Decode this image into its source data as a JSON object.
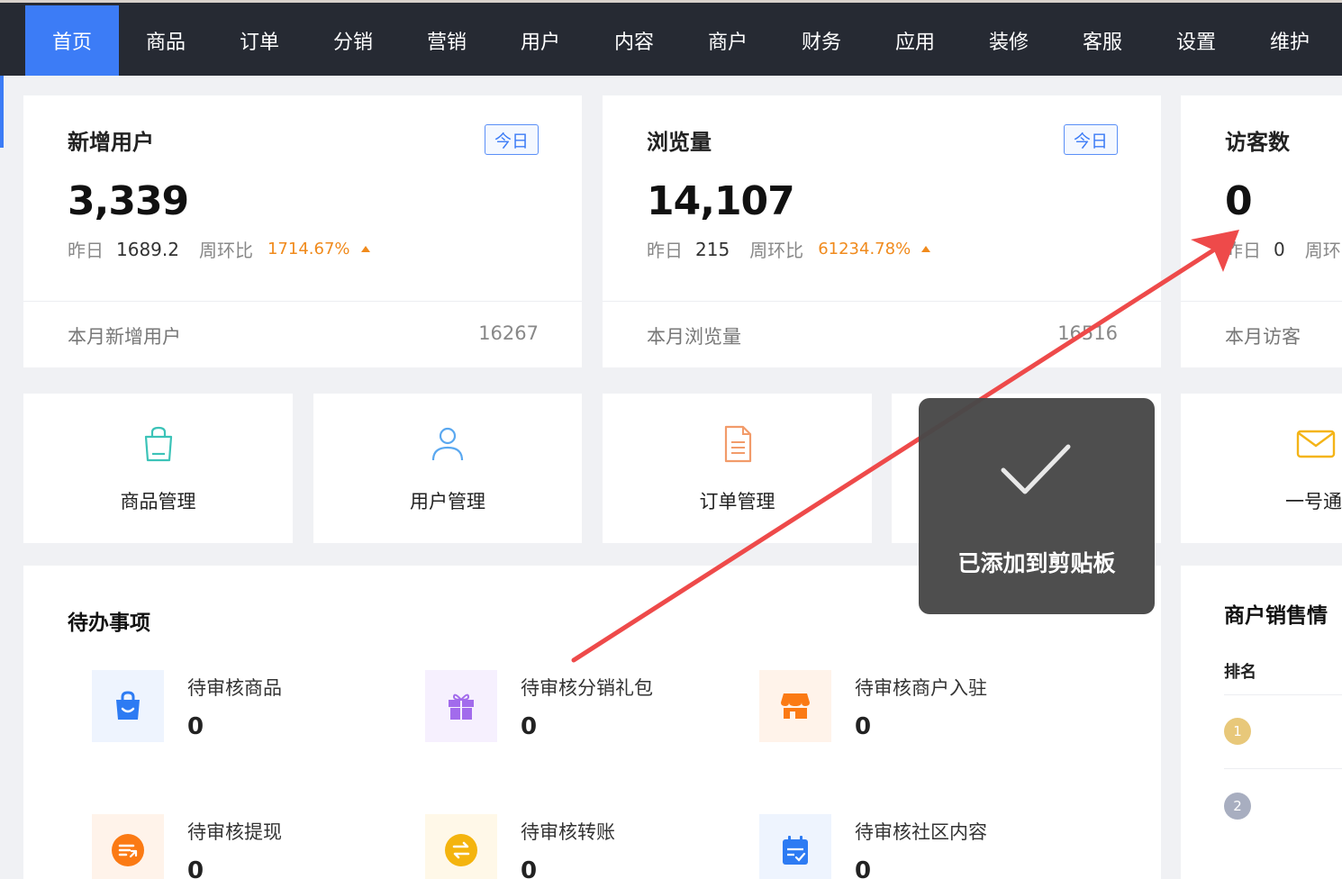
{
  "nav": {
    "items": [
      "首页",
      "商品",
      "订单",
      "分销",
      "营销",
      "用户",
      "内容",
      "商户",
      "财务",
      "应用",
      "装修",
      "客服",
      "设置",
      "维护"
    ],
    "active_index": 0,
    "accent_color": "#3c7cf6"
  },
  "stats": [
    {
      "title": "新增用户",
      "badge": "今日",
      "value": "3,339",
      "yesterday_label": "昨日",
      "yesterday_value": "1689.2",
      "wow_label": "周环比",
      "wow_value": "1714.67%",
      "footer_label": "本月新增用户",
      "footer_value": "16267"
    },
    {
      "title": "浏览量",
      "badge": "今日",
      "value": "14,107",
      "yesterday_label": "昨日",
      "yesterday_value": "215",
      "wow_label": "周环比",
      "wow_value": "61234.78%",
      "footer_label": "本月浏览量",
      "footer_value": "16516"
    },
    {
      "title": "访客数",
      "value": "0",
      "yesterday_label": "昨日",
      "yesterday_value": "0",
      "wow_label": "周环",
      "footer_label": "本月访客"
    }
  ],
  "quick_links": [
    {
      "label": "商品管理",
      "icon": "shopping-bag-icon"
    },
    {
      "label": "用户管理",
      "icon": "user-icon"
    },
    {
      "label": "订单管理",
      "icon": "document-icon"
    },
    {
      "label": "",
      "icon": ""
    },
    {
      "label": "一号通",
      "icon": "mail-icon"
    }
  ],
  "todo": {
    "title": "待办事项",
    "items": [
      {
        "label": "待审核商品",
        "count": "0",
        "icon": "shopping-bag-smile-icon",
        "color": "#2d7bf3",
        "bg": "#eef4fe"
      },
      {
        "label": "待审核分销礼包",
        "count": "0",
        "icon": "gift-icon",
        "color": "#a26bec",
        "bg": "#f6f0fe"
      },
      {
        "label": "待审核商户入驻",
        "count": "0",
        "icon": "storefront-icon",
        "color": "#fb7a14",
        "bg": "#fff3ea"
      },
      {
        "label": "待审核提现",
        "count": "0",
        "icon": "withdraw-icon",
        "color": "#fb7a14",
        "bg": "#fff3ea"
      },
      {
        "label": "待审核转账",
        "count": "0",
        "icon": "transfer-icon",
        "color": "#f4b40e",
        "bg": "#fff8e8"
      },
      {
        "label": "待审核社区内容",
        "count": "0",
        "icon": "calendar-check-icon",
        "color": "#2d7bf3",
        "bg": "#eef4fe"
      }
    ]
  },
  "merchant_sales": {
    "title": "商户销售情",
    "rank_header": "排名",
    "ranks": [
      {
        "n": "1",
        "color": "#e8c87a"
      },
      {
        "n": "2",
        "color": "#a8aec0"
      }
    ]
  },
  "toast": {
    "message": "已添加到剪贴板",
    "icon": "checkmark-icon"
  },
  "annotation": {
    "icon": "red-arrow-icon",
    "color": "#ee4a4a"
  }
}
